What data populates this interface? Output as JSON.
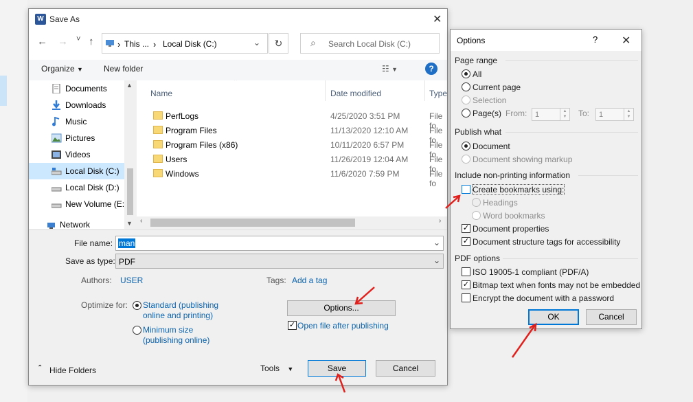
{
  "saveas": {
    "title": "Save As",
    "nav": {
      "back": "←",
      "forward": "→",
      "recent": "˅",
      "up": "↑"
    },
    "address": {
      "seg1": "This ...",
      "seg2": "Local Disk (C:)"
    },
    "search_placeholder": "Search Local Disk (C:)",
    "organize": "Organize",
    "new_folder": "New folder",
    "sidebar": [
      {
        "label": "Documents",
        "icon": "documents-icon"
      },
      {
        "label": "Downloads",
        "icon": "downloads-icon"
      },
      {
        "label": "Music",
        "icon": "music-icon"
      },
      {
        "label": "Pictures",
        "icon": "pictures-icon"
      },
      {
        "label": "Videos",
        "icon": "videos-icon"
      },
      {
        "label": "Local Disk (C:)",
        "icon": "drive-icon"
      },
      {
        "label": "Local Disk (D:)",
        "icon": "drive-icon"
      },
      {
        "label": "New Volume (E:)",
        "icon": "drive-icon"
      },
      {
        "label": "Network",
        "icon": "network-icon"
      }
    ],
    "columns": {
      "name": "Name",
      "date": "Date modified",
      "type": "Type"
    },
    "files": [
      {
        "name": "PerfLogs",
        "date": "4/25/2020 3:51 PM",
        "type": "File fo"
      },
      {
        "name": "Program Files",
        "date": "11/13/2020 12:10 AM",
        "type": "File fo"
      },
      {
        "name": "Program Files (x86)",
        "date": "10/11/2020 6:57 PM",
        "type": "File fo"
      },
      {
        "name": "Users",
        "date": "11/26/2019 12:04 AM",
        "type": "File fo"
      },
      {
        "name": "Windows",
        "date": "11/6/2020 7:59 PM",
        "type": "File fo"
      }
    ],
    "file_name_label": "File name:",
    "file_name_value": "man",
    "save_type_label": "Save as type:",
    "save_type_value": "PDF",
    "authors_label": "Authors:",
    "authors_value": "USER",
    "tags_label": "Tags:",
    "tags_value": "Add a tag",
    "optimize_label": "Optimize for:",
    "optimize_standard": "Standard (publishing",
    "optimize_standard_2": "online and printing)",
    "optimize_minimum": "Minimum size",
    "optimize_minimum_2": "(publishing online)",
    "options_button": "Options...",
    "open_after": "Open file after publishing",
    "hide_folders": "Hide Folders",
    "tools": "Tools",
    "save": "Save",
    "cancel": "Cancel"
  },
  "options": {
    "title": "Options",
    "help": "?",
    "page_range": "Page range",
    "all": "All",
    "current_page": "Current page",
    "selection": "Selection",
    "pages": "Page(s)",
    "from": "From:",
    "from_value": "1",
    "to": "To:",
    "to_value": "1",
    "publish_what": "Publish what",
    "document": "Document",
    "document_markup": "Document showing markup",
    "include_nonprinting": "Include non-printing information",
    "create_bookmarks": "Create bookmarks using:",
    "headings": "Headings",
    "word_bookmarks": "Word bookmarks",
    "document_properties": "Document properties",
    "structure_tags": "Document structure tags for accessibility",
    "pdf_options": "PDF options",
    "iso": "ISO 19005-1 compliant (PDF/A)",
    "bitmap_text": "Bitmap text when fonts may not be embedded",
    "encrypt": "Encrypt the document with a password",
    "ok": "OK",
    "cancel": "Cancel"
  },
  "colors": {
    "accent": "#0078d7",
    "link": "#0b63ad",
    "annotation_arrow": "#e0201c"
  }
}
